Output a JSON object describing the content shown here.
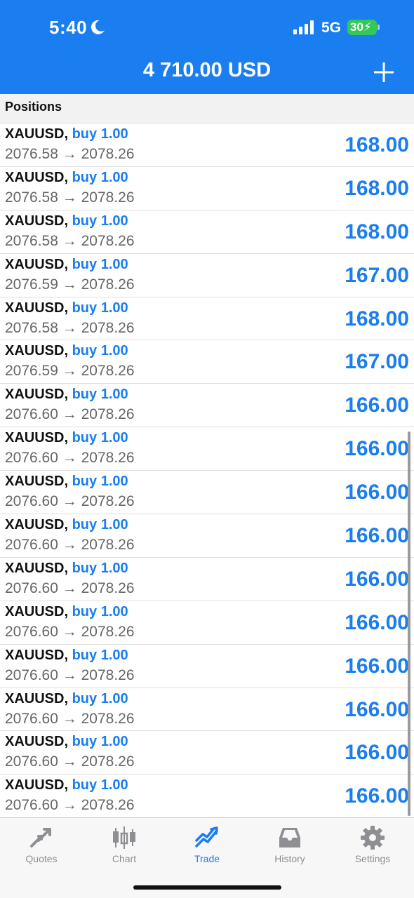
{
  "status_bar": {
    "time": "5:40",
    "network": "5G",
    "battery": "30"
  },
  "header": {
    "balance": "4 710.00 USD"
  },
  "section": {
    "title": "Positions"
  },
  "colors": {
    "accent": "#1a7df0",
    "battery": "#34c759"
  },
  "positions": [
    {
      "symbol": "XAUUSD",
      "side": "buy 1.00",
      "open": "2076.58",
      "arrow": "→",
      "current": "2078.26",
      "profit": "168.00"
    },
    {
      "symbol": "XAUUSD",
      "side": "buy 1.00",
      "open": "2076.58",
      "arrow": "→",
      "current": "2078.26",
      "profit": "168.00"
    },
    {
      "symbol": "XAUUSD",
      "side": "buy 1.00",
      "open": "2076.58",
      "arrow": "→",
      "current": "2078.26",
      "profit": "168.00"
    },
    {
      "symbol": "XAUUSD",
      "side": "buy 1.00",
      "open": "2076.59",
      "arrow": "→",
      "current": "2078.26",
      "profit": "167.00"
    },
    {
      "symbol": "XAUUSD",
      "side": "buy 1.00",
      "open": "2076.58",
      "arrow": "→",
      "current": "2078.26",
      "profit": "168.00"
    },
    {
      "symbol": "XAUUSD",
      "side": "buy 1.00",
      "open": "2076.59",
      "arrow": "→",
      "current": "2078.26",
      "profit": "167.00"
    },
    {
      "symbol": "XAUUSD",
      "side": "buy 1.00",
      "open": "2076.60",
      "arrow": "→",
      "current": "2078.26",
      "profit": "166.00"
    },
    {
      "symbol": "XAUUSD",
      "side": "buy 1.00",
      "open": "2076.60",
      "arrow": "→",
      "current": "2078.26",
      "profit": "166.00"
    },
    {
      "symbol": "XAUUSD",
      "side": "buy 1.00",
      "open": "2076.60",
      "arrow": "→",
      "current": "2078.26",
      "profit": "166.00"
    },
    {
      "symbol": "XAUUSD",
      "side": "buy 1.00",
      "open": "2076.60",
      "arrow": "→",
      "current": "2078.26",
      "profit": "166.00"
    },
    {
      "symbol": "XAUUSD",
      "side": "buy 1.00",
      "open": "2076.60",
      "arrow": "→",
      "current": "2078.26",
      "profit": "166.00"
    },
    {
      "symbol": "XAUUSD",
      "side": "buy 1.00",
      "open": "2076.60",
      "arrow": "→",
      "current": "2078.26",
      "profit": "166.00"
    },
    {
      "symbol": "XAUUSD",
      "side": "buy 1.00",
      "open": "2076.60",
      "arrow": "→",
      "current": "2078.26",
      "profit": "166.00"
    },
    {
      "symbol": "XAUUSD",
      "side": "buy 1.00",
      "open": "2076.60",
      "arrow": "→",
      "current": "2078.26",
      "profit": "166.00"
    },
    {
      "symbol": "XAUUSD",
      "side": "buy 1.00",
      "open": "2076.60",
      "arrow": "→",
      "current": "2078.26",
      "profit": "166.00"
    },
    {
      "symbol": "XAUUSD",
      "side": "buy 1.00",
      "open": "2076.60",
      "arrow": "→",
      "current": "2078.26",
      "profit": "166.00"
    }
  ],
  "tabs": [
    {
      "label": "Quotes",
      "icon": "quotes-arrows-icon",
      "active": false
    },
    {
      "label": "Chart",
      "icon": "candlestick-chart-icon",
      "active": false
    },
    {
      "label": "Trade",
      "icon": "trade-trend-icon",
      "active": true
    },
    {
      "label": "History",
      "icon": "history-tray-icon",
      "active": false
    },
    {
      "label": "Settings",
      "icon": "gear-icon",
      "active": false
    }
  ]
}
